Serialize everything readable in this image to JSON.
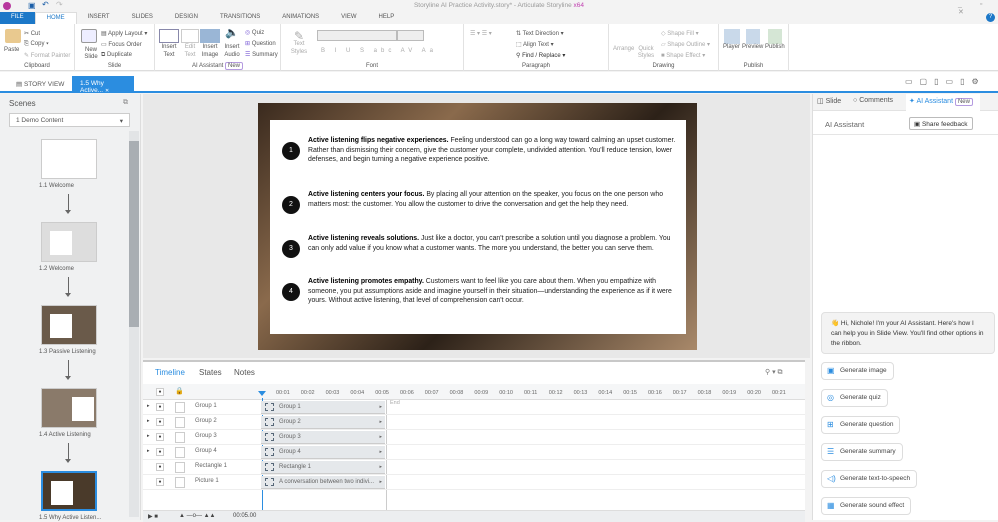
{
  "title_bar": {
    "doc": "Storyline AI Practice Activity.story* - Articulate Storyline",
    "edition": "x64"
  },
  "menu_tabs": [
    "FILE",
    "HOME",
    "INSERT",
    "SLIDES",
    "DESIGN",
    "TRANSITIONS",
    "ANIMATIONS",
    "VIEW",
    "HELP"
  ],
  "ribbon": {
    "clipboard": {
      "label": "Clipboard",
      "paste": "Paste",
      "cut": "Cut",
      "copy": "Copy",
      "format_painter": "Format Painter"
    },
    "slide": {
      "label": "Slide",
      "new_slide": "New Slide",
      "apply_layout": "Apply Layout",
      "focus_order": "Focus Order",
      "duplicate": "Duplicate"
    },
    "ai": {
      "label": "AI Assistant",
      "badge": "New",
      "insert_text": "Insert Text",
      "edit_text": "Edit Text",
      "insert_image": "Insert Image",
      "insert_audio": "Insert Audio",
      "quiz": "Quiz",
      "question": "Question",
      "summary": "Summary"
    },
    "font": {
      "label": "Font",
      "text_styles": "Text Styles"
    },
    "paragraph": {
      "label": "Paragraph",
      "text_direction": "Text Direction",
      "align_text": "Align Text",
      "find_replace": "Find / Replace"
    },
    "drawing": {
      "label": "Drawing",
      "arrange": "Arrange",
      "quick_styles": "Quick Styles",
      "shape_fill": "Shape Fill",
      "shape_outline": "Shape Outline",
      "shape_effect": "Shape Effect"
    },
    "publish": {
      "label": "Publish",
      "player": "Player",
      "preview": "Preview",
      "publish": "Publish"
    }
  },
  "doc_tabs": {
    "story_view": "STORY VIEW",
    "active": "1.5 Why Active..."
  },
  "scenes": {
    "title": "Scenes",
    "selected": "1 Demo Content",
    "slides": [
      "1.1 Welcome",
      "1.2 Welcome",
      "1.3 Passive Listening",
      "1.4 Active Listening",
      "1.5 Why Active Listen..."
    ]
  },
  "slide_points": [
    {
      "n": "1",
      "title": "Active listening flips negative experiences.",
      "body": " Feeling understood can go a long way toward calming an upset customer. Rather than dismissing their concern, give the customer your complete, undivided attention. You'll reduce tension, lower defenses, and begin turning a negative experience positive."
    },
    {
      "n": "2",
      "title": "Active listening centers your focus.",
      "body": " By placing all your attention on the speaker, you focus on the one person who matters most: the customer. You allow the customer to drive the conversation and get the help they need."
    },
    {
      "n": "3",
      "title": "Active listening reveals solutions.",
      "body": " Just like a doctor, you can't prescribe a solution until you diagnose a problem. You can only add value if you know what a customer wants. The more you understand, the better you can serve them."
    },
    {
      "n": "4",
      "title": "Active listening promotes empathy.",
      "body": " Customers want to feel like you care about them. When you empathize with someone, you put assumptions aside and imagine yourself in their situation—understanding the experience as if it were yours. Without active listening, that level of comprehension can't occur."
    }
  ],
  "timeline": {
    "tabs": [
      "Timeline",
      "States",
      "Notes"
    ],
    "ticks": [
      "00:01",
      "00:02",
      "00:03",
      "00:04",
      "00:05",
      "00:06",
      "00:07",
      "00:08",
      "00:09",
      "00:10",
      "00:11",
      "00:12",
      "00:13",
      "00:14",
      "00:15",
      "00:16",
      "00:17",
      "00:18",
      "00:19",
      "00:20",
      "00:21"
    ],
    "end_label": "End",
    "duration": "00:05.00",
    "rows": [
      {
        "name": "Group 1",
        "bar": "Group 1"
      },
      {
        "name": "Group 2",
        "bar": "Group 2"
      },
      {
        "name": "Group 3",
        "bar": "Group 3"
      },
      {
        "name": "Group 4",
        "bar": "Group 4"
      },
      {
        "name": "Rectangle 1",
        "bar": "Rectangle 1"
      },
      {
        "name": "Picture 1",
        "bar": "A conversation between two indivi..."
      }
    ]
  },
  "right_panel": {
    "tabs": {
      "slide": "Slide",
      "comments": "Comments",
      "ai": "AI Assistant",
      "badge": "New"
    },
    "heading": "AI Assistant",
    "share": "Share feedback",
    "greeting": "👋 Hi, Nichole! I'm your AI Assistant. Here's how I can help you in Slide View. You'll find other options in the ribbon.",
    "actions": [
      {
        "label": "Generate image",
        "icon": "image-icon"
      },
      {
        "label": "Generate quiz",
        "icon": "quiz-icon"
      },
      {
        "label": "Generate question",
        "icon": "question-icon"
      },
      {
        "label": "Generate summary",
        "icon": "summary-icon"
      },
      {
        "label": "Generate text-to-speech",
        "icon": "speaker-icon"
      },
      {
        "label": "Generate sound effect",
        "icon": "sound-effect-icon"
      }
    ]
  },
  "colors": {
    "accent": "#1c78c8",
    "badge_border": "#b59be0"
  }
}
